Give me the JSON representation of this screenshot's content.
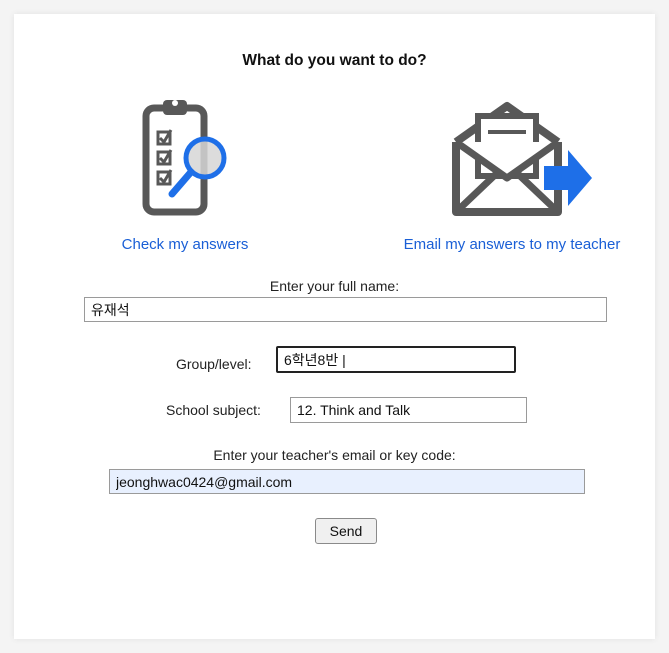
{
  "heading": "What do you want to do?",
  "options": {
    "check": {
      "label": "Check my answers",
      "icon": "clipboard-magnifier-icon"
    },
    "email": {
      "label": "Email my answers to my teacher",
      "icon": "envelope-send-icon"
    }
  },
  "form": {
    "name_label": "Enter your full name:",
    "name_value": "유재석",
    "group_label": "Group/level:",
    "group_value": "6학년8반 |",
    "subject_label": "School subject:",
    "subject_value": "12. Think and Talk",
    "email_label": "Enter your teacher's email or key code:",
    "email_value": "jeonghwac0424@gmail.com",
    "send_label": "Send"
  },
  "colors": {
    "link_blue": "#1a5fd6",
    "icon_blue": "#1e6fe8",
    "icon_gray": "#585858",
    "autofill_bg": "#e8f0fe"
  }
}
